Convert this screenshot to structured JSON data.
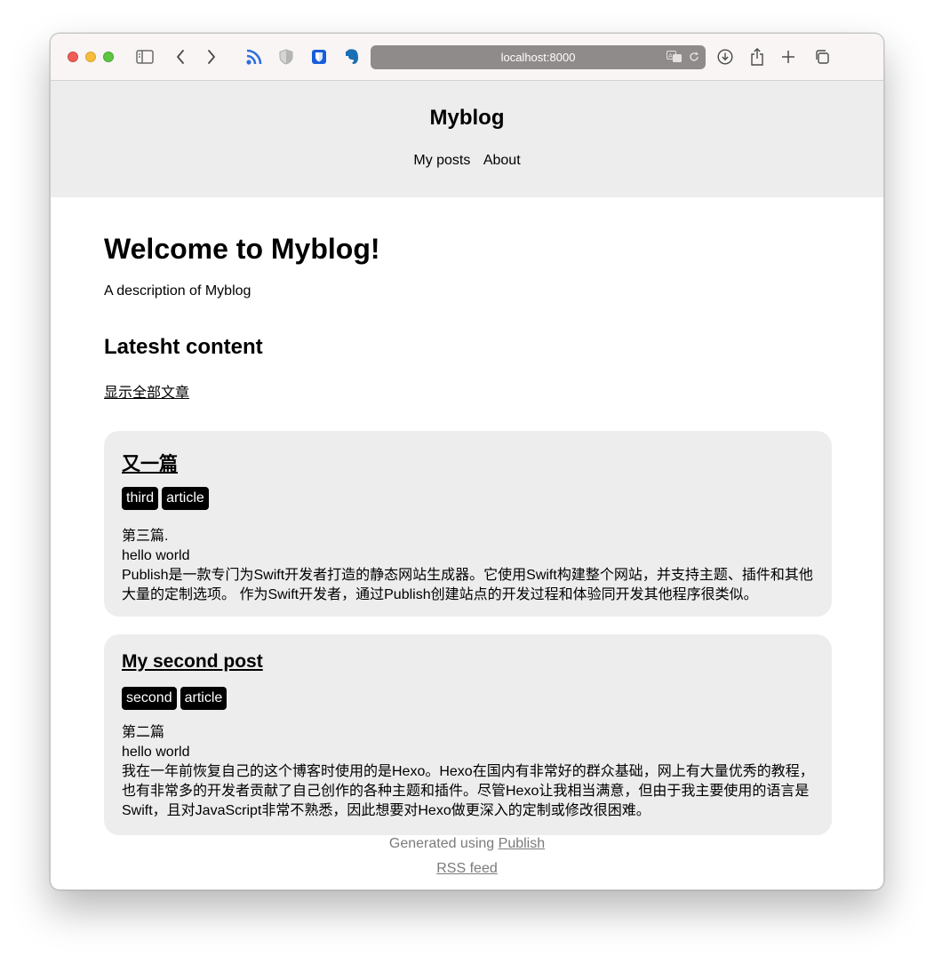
{
  "browser": {
    "url": "localhost:8000",
    "icons": [
      "sidebar-icon",
      "back-icon",
      "forward-icon",
      "rss-icon",
      "shield-icon",
      "bitwarden-icon",
      "evernote-icon",
      "translate-icon",
      "reload-icon",
      "download-icon",
      "share-icon",
      "new-tab-icon",
      "tabs-icon"
    ],
    "colors": {
      "toolbar": "#f8f5f4",
      "urlbar": "#8f8b8a",
      "rss": "#2f6fe0"
    }
  },
  "header": {
    "site_title": "Myblog",
    "nav": [
      "My posts",
      "About"
    ]
  },
  "main": {
    "heading": "Welcome to Myblog!",
    "description": "A description of Myblog",
    "latest_heading": "Latesht content",
    "show_all_link": "显示全部文章",
    "posts": [
      {
        "title": "又一篇",
        "tags": [
          "third",
          "article"
        ],
        "lines": [
          "第三篇.",
          "hello world",
          "Publish是一款专门为Swift开发者打造的静态网站生成器。它使用Swift构建整个网站，并支持主题、插件和其他",
          "大量的定制选项。 作为Swift开发者，通过Publish创建站点的开发过程和体验同开发其他程序很类似。"
        ]
      },
      {
        "title": "My second post",
        "tags": [
          "second",
          "article"
        ],
        "lines": [
          "第二篇",
          "hello world",
          "我在一年前恢复自己的这个博客时使用的是Hexo。Hexo在国内有非常好的群众基础，网上有大量优秀的教程，",
          "也有非常多的开发者贡献了自己创作的各种主题和插件。尽管Hexo让我相当满意，但由于我主要使用的语言是",
          "Swift，且对JavaScript非常不熟悉，因此想要对Hexo做更深入的定制或修改很困难。"
        ]
      }
    ]
  },
  "footer": {
    "generated_prefix": "Generated using",
    "publish_link": "Publish",
    "rss_link": "RSS feed"
  }
}
